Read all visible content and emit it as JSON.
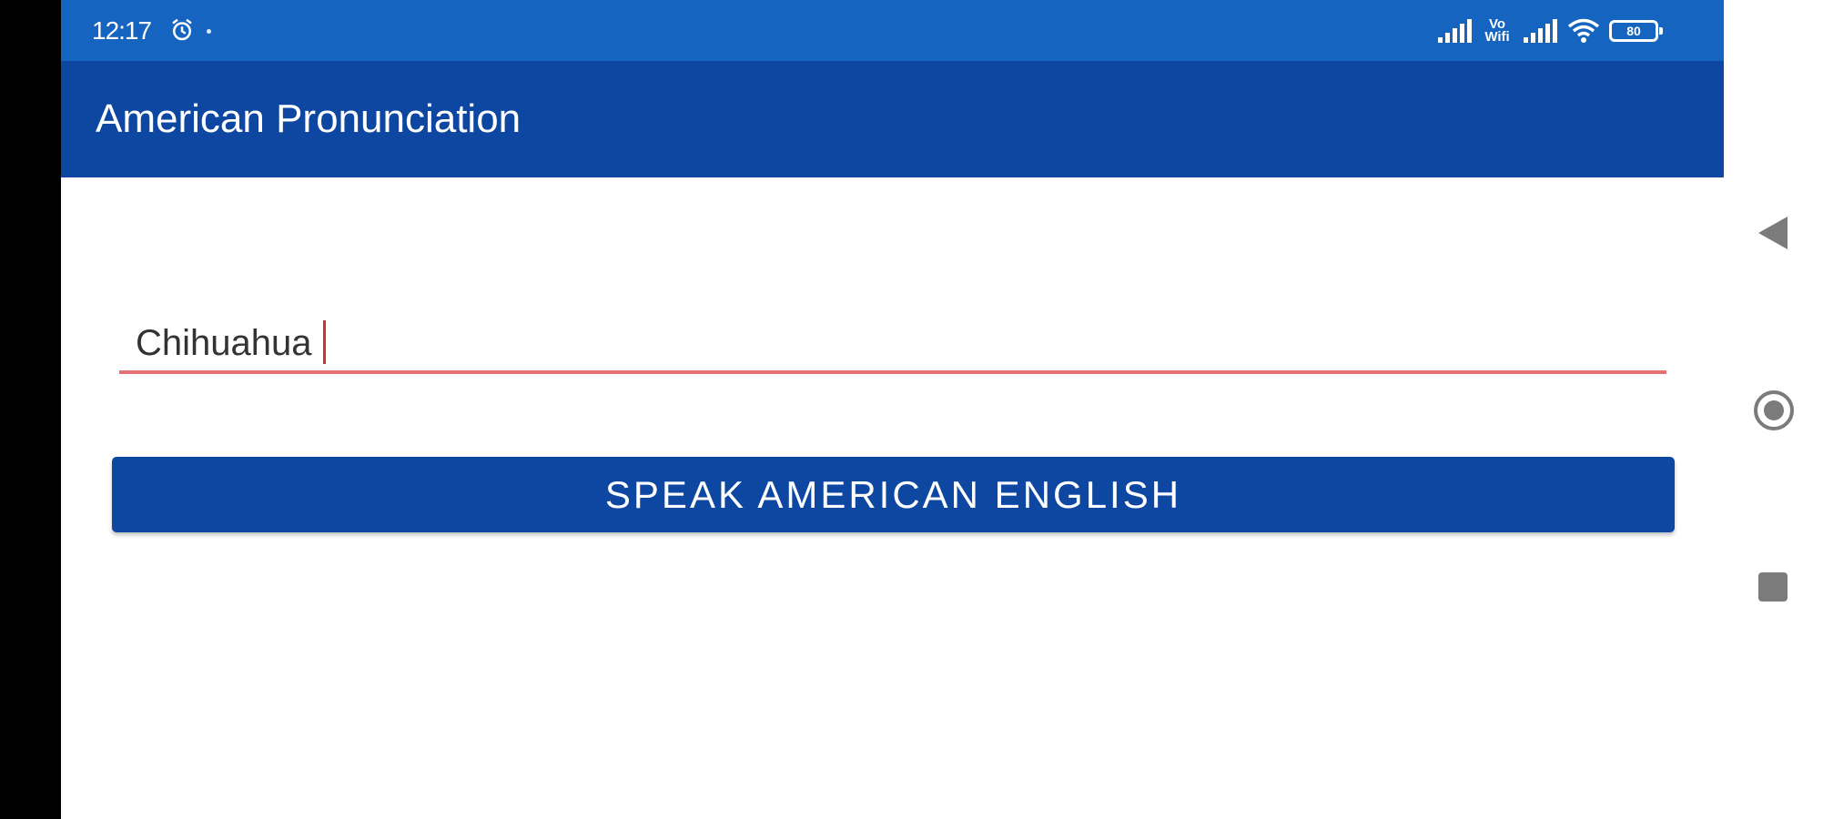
{
  "status_bar": {
    "time": "12:17",
    "volte_label": "Vo\nWiFi",
    "battery_level": "80",
    "icons": [
      "alarm-icon",
      "signal-icon",
      "volte-icon",
      "signal-icon",
      "wifi-icon",
      "battery-icon"
    ]
  },
  "app_bar": {
    "title": "American Pronunciation"
  },
  "main": {
    "input_value": "Chihuahua",
    "speak_button_label": "SPEAK AMERICAN ENGLISH"
  },
  "nav_bar": {
    "icons": [
      "back-icon",
      "home-icon",
      "recents-icon"
    ]
  },
  "colors": {
    "status_bar": "#1565c0",
    "app_bar": "#0d47a1",
    "button": "#0d47a1",
    "input_underline": "#e57373",
    "caret": "#d32f2f"
  }
}
